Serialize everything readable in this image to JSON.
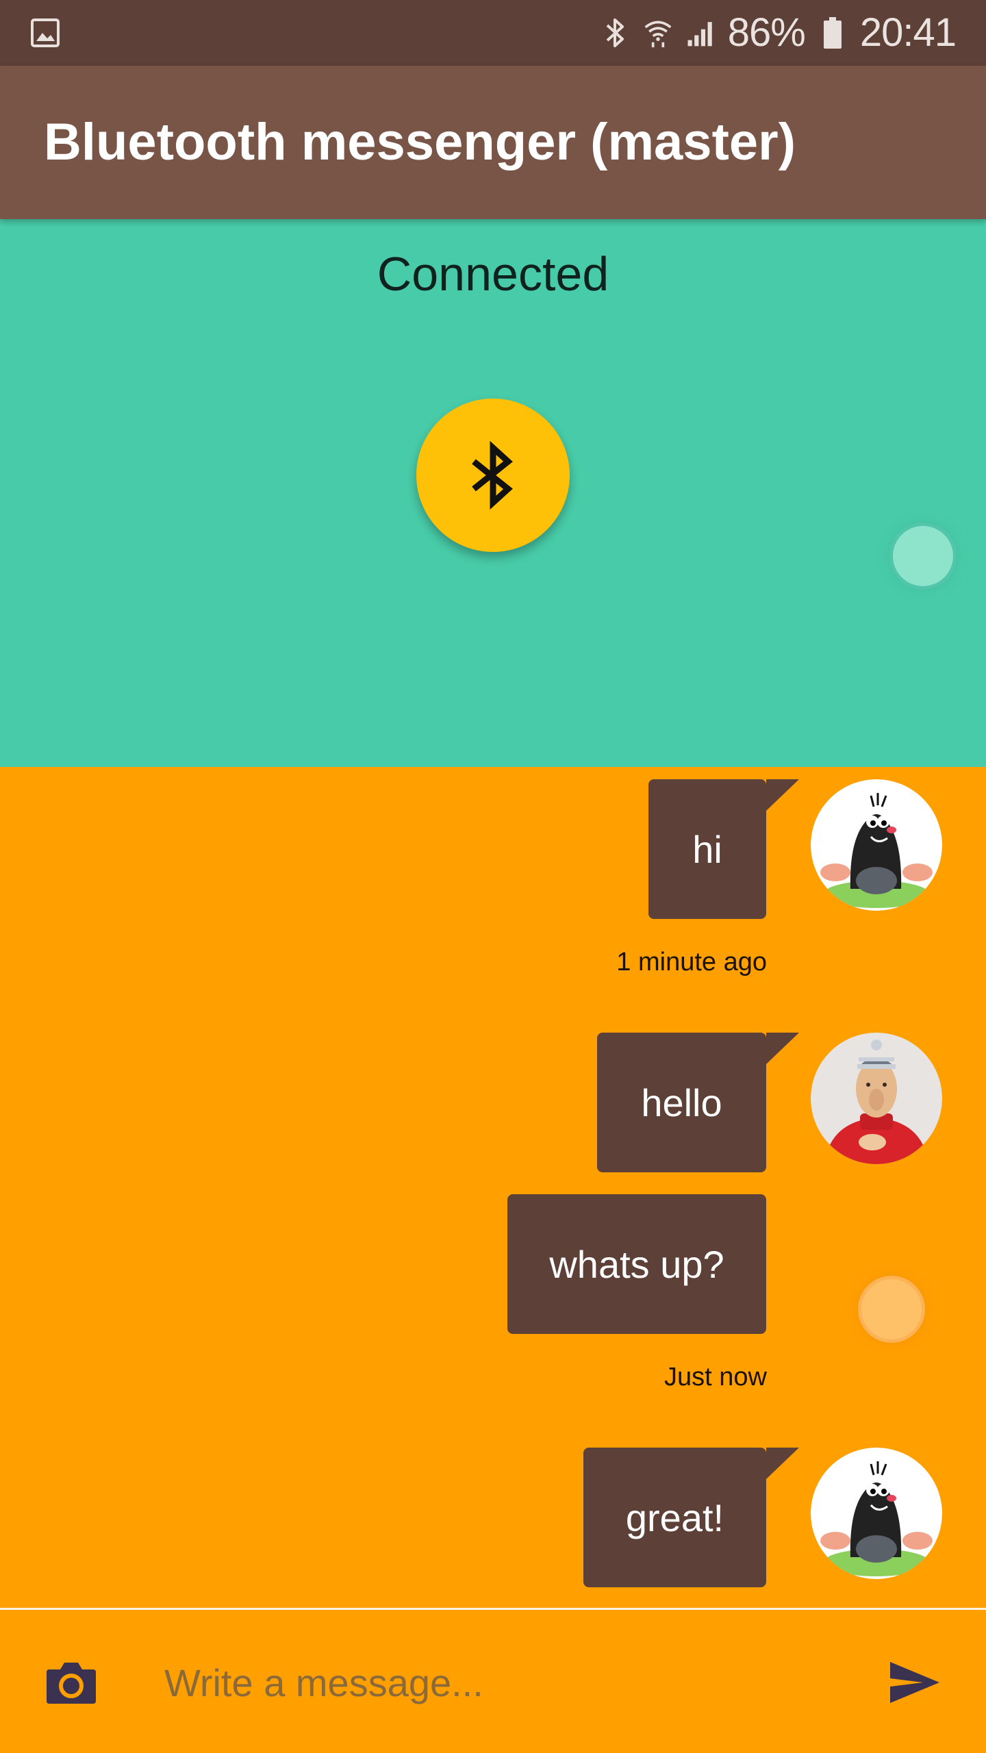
{
  "status_bar": {
    "battery": "86%",
    "time": "20:41"
  },
  "app_bar": {
    "title": "Bluetooth messenger (master)"
  },
  "connection": {
    "status": "Connected"
  },
  "messages": [
    {
      "text": "hi",
      "avatar": "mole-avatar"
    },
    {
      "text": "hello",
      "avatar": "neighbor-avatar"
    },
    {
      "text": "whats up?",
      "avatar": ""
    },
    {
      "text": "great!",
      "avatar": "mole-avatar"
    }
  ],
  "timestamps": [
    "1 minute ago",
    "Just now"
  ],
  "composer": {
    "placeholder": "Write a message..."
  },
  "colors": {
    "status_bar": "#5d4037",
    "app_bar": "#795548",
    "connection_panel": "#48cba8",
    "chat_background": "#ff9f00",
    "bubble": "#5d4037",
    "fab": "#ffc107",
    "icon_dark": "#3b3252"
  }
}
